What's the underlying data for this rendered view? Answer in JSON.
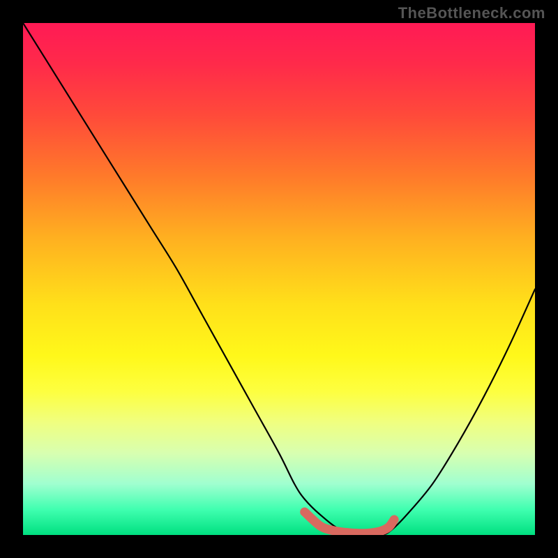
{
  "watermark": "TheBottleneck.com",
  "chart_data": {
    "type": "line",
    "title": "",
    "xlabel": "",
    "ylabel": "",
    "xlim": [
      0,
      100
    ],
    "ylim": [
      0,
      100
    ],
    "grid": false,
    "legend": false,
    "x": [
      0,
      5,
      10,
      15,
      20,
      25,
      30,
      35,
      40,
      45,
      50,
      53,
      55,
      58,
      62,
      66,
      70,
      72,
      75,
      80,
      85,
      90,
      95,
      100
    ],
    "values": [
      100,
      92,
      84,
      76,
      68,
      60,
      52,
      43,
      34,
      25,
      16,
      10,
      7,
      4,
      1,
      0,
      0,
      1,
      4,
      10,
      18,
      27,
      37,
      48
    ],
    "curve_color": "#000000",
    "marker_segment": {
      "x": [
        55,
        58,
        60,
        62,
        64,
        66,
        68,
        70,
        71.5,
        72.5
      ],
      "values": [
        4.5,
        1.8,
        1.0,
        0.6,
        0.4,
        0.3,
        0.4,
        0.8,
        1.6,
        3.0
      ],
      "color": "#d9695f"
    },
    "background_gradient": {
      "top": "#ff1a55",
      "middle": "#ffe01a",
      "bottom": "#00e080"
    },
    "annotations": []
  }
}
